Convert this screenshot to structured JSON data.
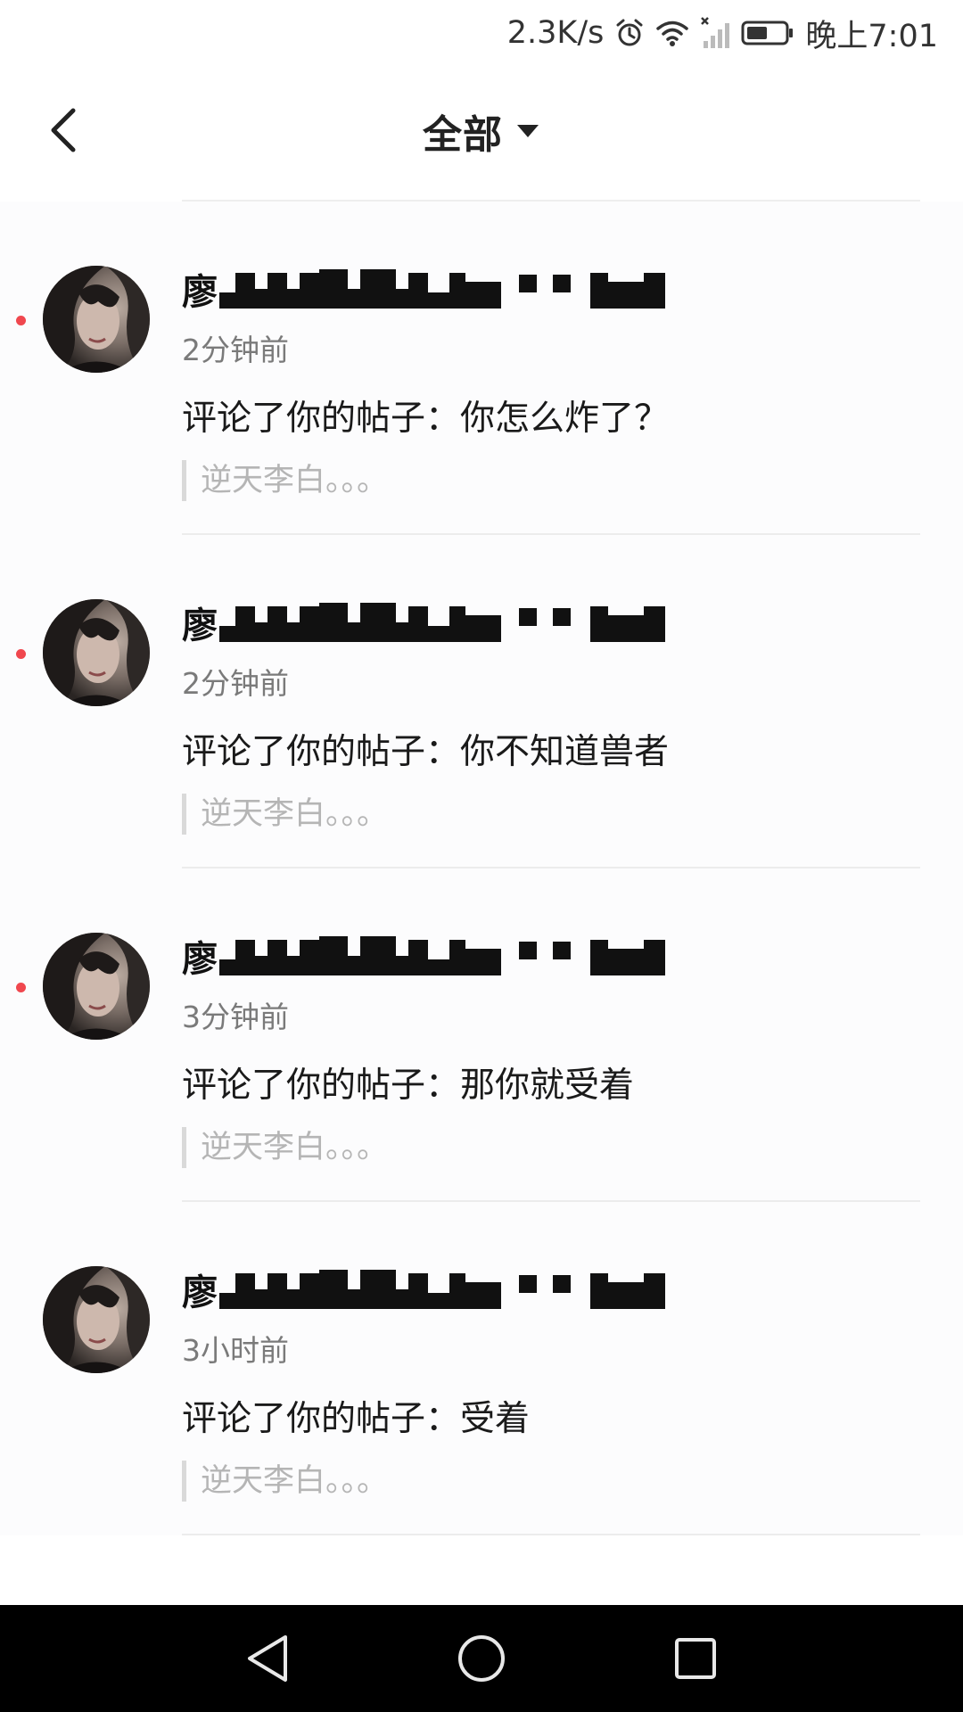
{
  "status_bar": {
    "net_speed": "2.3K/s",
    "time": "晚上7:01",
    "icons": [
      "alarm-icon",
      "wifi-icon",
      "no-signal-icon",
      "battery-icon"
    ]
  },
  "header": {
    "title": "全部",
    "back_icon": "chevron-left-icon",
    "dropdown_icon": "triangle-down-icon"
  },
  "colors": {
    "unread_dot": "#f0474e",
    "nav_bar": "#000000",
    "divider": "#ececec"
  },
  "notifications": [
    {
      "name_visible": "廖",
      "name_redacted": true,
      "time": "2分钟前",
      "comment": "评论了你的帖子：你怎么炸了？",
      "quote": "逆天李白。。。",
      "unread": true
    },
    {
      "name_visible": "廖",
      "name_redacted": true,
      "time": "2分钟前",
      "comment": "评论了你的帖子：你不知道兽者",
      "quote": "逆天李白。。。",
      "unread": true
    },
    {
      "name_visible": "廖",
      "name_redacted": true,
      "time": "3分钟前",
      "comment": "评论了你的帖子：那你就受着",
      "quote": "逆天李白。。。",
      "unread": true
    },
    {
      "name_visible": "廖",
      "name_redacted": true,
      "time": "3小时前",
      "comment": "评论了你的帖子：受着",
      "quote": "逆天李白。。。",
      "unread": false
    }
  ],
  "nav_bar": {
    "buttons": [
      "back-triangle-icon",
      "home-circle-icon",
      "recents-square-icon"
    ]
  }
}
